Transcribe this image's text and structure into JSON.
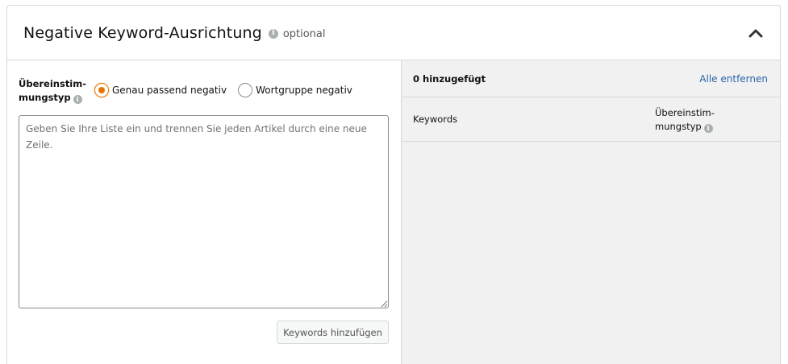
{
  "section": {
    "title": "Negative Keyword-Ausrichtung",
    "optional_label": "optional",
    "info_icon": "info-icon",
    "collapse_icon": "chevron-up-icon"
  },
  "match_type": {
    "label_line1": "Übereinstim-",
    "label_line2": "mungstyp",
    "options": [
      {
        "label": "Genau passend negativ",
        "selected": true
      },
      {
        "label": "Wortgruppe negativ",
        "selected": false
      }
    ],
    "selected_color": "#e77600"
  },
  "keyword_input": {
    "placeholder": "Geben Sie Ihre Liste ein und trennen Sie jeden Artikel durch eine neue Zeile.",
    "value": ""
  },
  "add_button": {
    "label": "Keywords hinzufügen"
  },
  "added_panel": {
    "count_label": "0 hinzugefügt",
    "remove_all_label": "Alle entfernen",
    "link_color": "#2a64a8",
    "columns": {
      "keywords": "Keywords",
      "match_line1": "Übereinstim-",
      "match_line2": "mungstyp"
    },
    "rows": []
  }
}
